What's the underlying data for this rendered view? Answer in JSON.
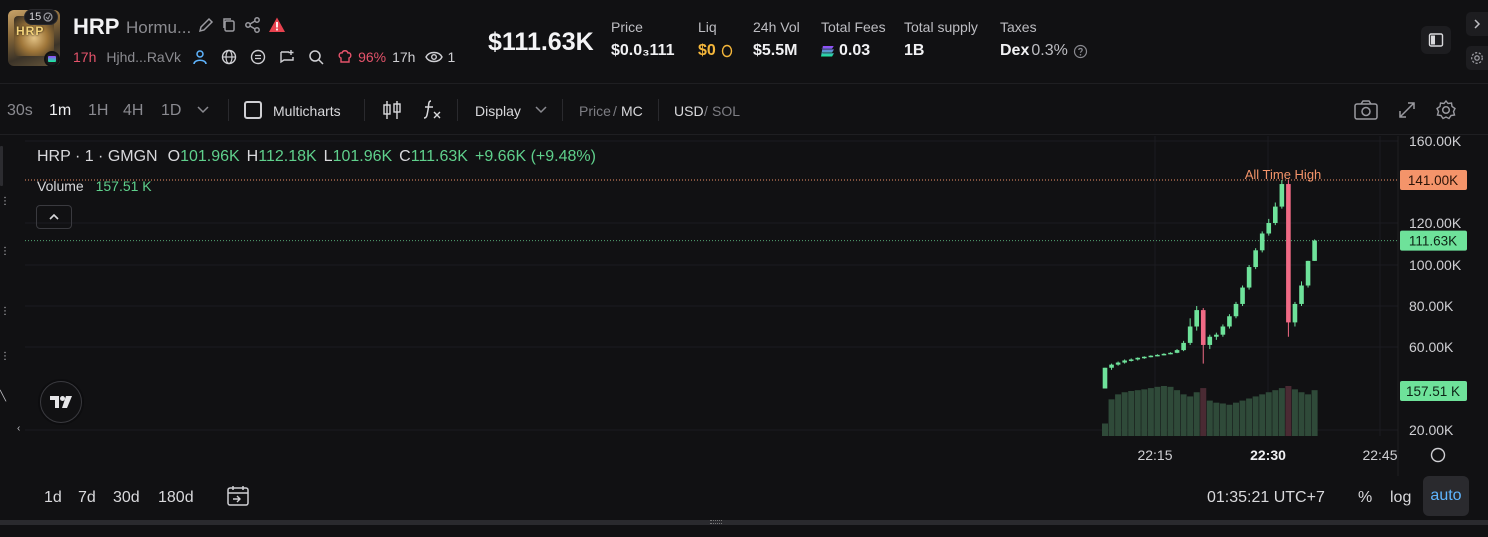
{
  "token": {
    "rank": "15",
    "logo_text": "HRP",
    "symbol": "HRP",
    "name": "Hormu...",
    "age": "17h",
    "creator": "Hjhd...RaVk",
    "pct": "96%",
    "pct_age": "17h",
    "viewers": "1"
  },
  "stats": {
    "price_big": "$111.63K",
    "price": {
      "label": "Price",
      "value": "$0.0₃111"
    },
    "liq": {
      "label": "Liq",
      "value": "$0"
    },
    "vol": {
      "label": "24h Vol",
      "value": "$5.5M"
    },
    "fees": {
      "label": "Total Fees",
      "value": "0.03"
    },
    "supply": {
      "label": "Total supply",
      "value": "1B"
    },
    "taxes": {
      "label": "Taxes",
      "value_prefix": "Dex",
      "value": "0.3%"
    }
  },
  "toolbar": {
    "timeframes": [
      "30s",
      "1m",
      "1H",
      "4H",
      "1D"
    ],
    "active_timeframe": "1m",
    "multicharts": "Multicharts",
    "display": "Display",
    "price": "Price",
    "mc": "MC",
    "usd": "USD",
    "sol": "SOL",
    "slash": "/"
  },
  "legend": {
    "title": "HRP · 1 · GMGN",
    "o_label": "O",
    "o": "101.96K",
    "h_label": "H",
    "h": "112.18K",
    "l_label": "L",
    "l": "101.96K",
    "c_label": "C",
    "c": "111.63K",
    "change": "+9.66K (+9.48%)",
    "volume_label": "Volume",
    "volume": "157.51 K"
  },
  "chart_data": {
    "type": "candlestick",
    "y_ticks": [
      "160.00K",
      "120.00K",
      "100.00K",
      "80.00K",
      "60.00K",
      "20.00K"
    ],
    "y_tick_values": [
      160000,
      120000,
      100000,
      80000,
      60000,
      20000
    ],
    "x_ticks": [
      "22:15",
      "22:30",
      "22:45"
    ],
    "ath_label": "All Time High",
    "ath_value_label": "141.00K",
    "ath_value": 141000,
    "last_price_label": "111.63K",
    "last_price": 111630,
    "volume_label": "157.51 K",
    "candles": [
      {
        "o": 40000,
        "h": 50000,
        "l": 40000,
        "c": 50000
      },
      {
        "o": 50000,
        "h": 52000,
        "l": 49000,
        "c": 51500
      },
      {
        "o": 51500,
        "h": 53000,
        "l": 51000,
        "c": 52500
      },
      {
        "o": 52500,
        "h": 54000,
        "l": 52000,
        "c": 53500
      },
      {
        "o": 53500,
        "h": 54500,
        "l": 53000,
        "c": 54000
      },
      {
        "o": 54000,
        "h": 55000,
        "l": 53500,
        "c": 54800
      },
      {
        "o": 54800,
        "h": 55500,
        "l": 54300,
        "c": 55300
      },
      {
        "o": 55300,
        "h": 56000,
        "l": 55000,
        "c": 55800
      },
      {
        "o": 55800,
        "h": 56500,
        "l": 55500,
        "c": 56200
      },
      {
        "o": 56200,
        "h": 57000,
        "l": 56000,
        "c": 56700
      },
      {
        "o": 56700,
        "h": 57500,
        "l": 56500,
        "c": 57200
      },
      {
        "o": 57200,
        "h": 59000,
        "l": 57000,
        "c": 58500
      },
      {
        "o": 58500,
        "h": 63000,
        "l": 58000,
        "c": 62000
      },
      {
        "o": 62000,
        "h": 74000,
        "l": 61000,
        "c": 70000
      },
      {
        "o": 70000,
        "h": 80000,
        "l": 68000,
        "c": 78000
      },
      {
        "o": 78000,
        "h": 79000,
        "l": 52000,
        "c": 61000
      },
      {
        "o": 61000,
        "h": 66000,
        "l": 59000,
        "c": 65000
      },
      {
        "o": 65000,
        "h": 67000,
        "l": 63500,
        "c": 66000
      },
      {
        "o": 66000,
        "h": 71000,
        "l": 65000,
        "c": 70000
      },
      {
        "o": 70000,
        "h": 76000,
        "l": 69000,
        "c": 75000
      },
      {
        "o": 75000,
        "h": 82000,
        "l": 74000,
        "c": 81000
      },
      {
        "o": 81000,
        "h": 90000,
        "l": 80000,
        "c": 89000
      },
      {
        "o": 89000,
        "h": 100000,
        "l": 88000,
        "c": 99000
      },
      {
        "o": 99000,
        "h": 108000,
        "l": 98000,
        "c": 107000
      },
      {
        "o": 107000,
        "h": 116000,
        "l": 106000,
        "c": 115000
      },
      {
        "o": 115000,
        "h": 122000,
        "l": 114000,
        "c": 120000
      },
      {
        "o": 120000,
        "h": 130000,
        "l": 119000,
        "c": 128000
      },
      {
        "o": 128000,
        "h": 141000,
        "l": 127000,
        "c": 139000
      },
      {
        "o": 139000,
        "h": 141000,
        "l": 65000,
        "c": 72000
      },
      {
        "o": 72000,
        "h": 82000,
        "l": 70000,
        "c": 81000
      },
      {
        "o": 81000,
        "h": 92000,
        "l": 80000,
        "c": 90000
      },
      {
        "o": 90000,
        "h": 102000,
        "l": 89000,
        "c": 101960
      },
      {
        "o": 101960,
        "h": 112180,
        "l": 101960,
        "c": 111630
      }
    ],
    "volumes": [
      30,
      88,
      100,
      105,
      108,
      110,
      112,
      115,
      118,
      120,
      118,
      110,
      100,
      95,
      105,
      115,
      85,
      80,
      78,
      75,
      80,
      85,
      90,
      95,
      100,
      105,
      110,
      115,
      120,
      112,
      105,
      100,
      110
    ]
  },
  "bottom": {
    "ranges": [
      "1d",
      "7d",
      "30d",
      "180d"
    ],
    "clock": "01:35:21 UTC+7",
    "percent": "%",
    "log": "log",
    "auto": "auto"
  },
  "colors": {
    "up": "#6ee29a",
    "down": "#f06a85",
    "ath": "#f4946a",
    "accent_blue": "#5fb5ff",
    "red": "#e5536b",
    "gold": "#f5b73b"
  }
}
